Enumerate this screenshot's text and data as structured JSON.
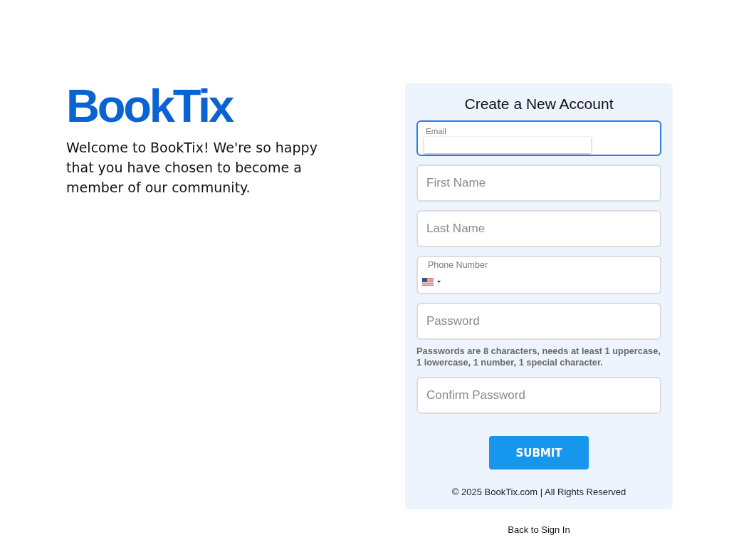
{
  "brand": {
    "logo": "BookTix",
    "welcome": "Welcome to BookTix! We're so happy that you have chosen to become a member of our community."
  },
  "form": {
    "title": "Create a New Account",
    "fields": [
      {
        "kind": "labeled",
        "label": "Email",
        "focused": true
      },
      {
        "kind": "text",
        "placeholder": "First Name",
        "focused": false
      },
      {
        "kind": "text",
        "placeholder": "Last Name",
        "focused": false
      },
      {
        "kind": "phone",
        "label": "Phone Number",
        "focused": false
      },
      {
        "kind": "text",
        "placeholder": "Password",
        "focused": false
      },
      {
        "kind": "hint",
        "text": "Passwords are 8 characters, needs at least 1 uppercase, 1 lowercase, 1 number, 1 special character."
      },
      {
        "kind": "text",
        "placeholder": "Confirm Password",
        "focused": false
      }
    ],
    "submit": "SUBMIT",
    "footer": "© 2025 BookTix.com | All Rights Reserved"
  },
  "back_link": "Back to Sign In"
}
